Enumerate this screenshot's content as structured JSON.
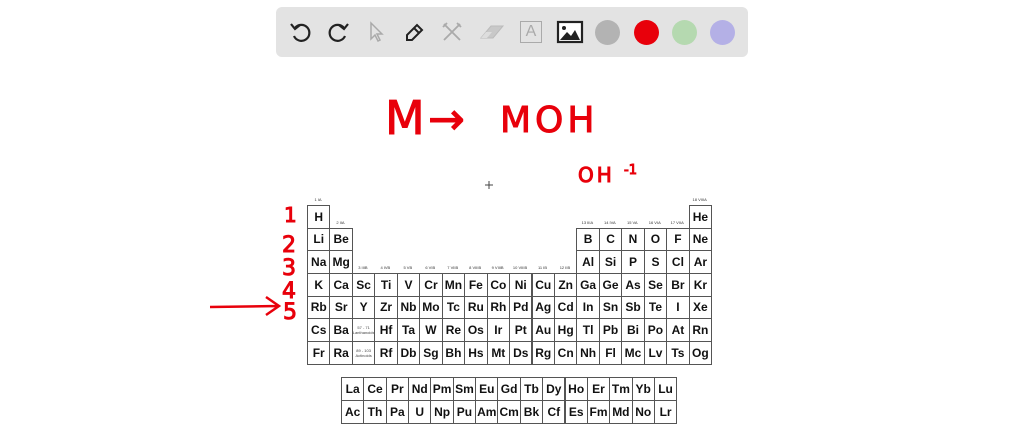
{
  "toolbar": {
    "tools": [
      {
        "name": "undo-icon",
        "label": "Undo"
      },
      {
        "name": "redo-icon",
        "label": "Redo"
      },
      {
        "name": "select-icon",
        "label": "Select"
      },
      {
        "name": "pen-icon",
        "label": "Pen"
      },
      {
        "name": "tools-icon",
        "label": "Tools"
      },
      {
        "name": "eraser-icon",
        "label": "Eraser"
      },
      {
        "name": "text-icon",
        "label": "Text"
      },
      {
        "name": "image-icon",
        "label": "Image"
      }
    ],
    "text_tool_glyph": "A",
    "colors": [
      "#b3b3b3",
      "#e8000b",
      "#b5d9b0",
      "#b4b0e6"
    ]
  },
  "annotations": {
    "reaction_m": "M",
    "reaction_arrow": "→",
    "reaction_product": "MOH",
    "hydroxide": "OH",
    "hydroxide_charge": "-1",
    "period_numbers": [
      "1",
      "2",
      "3",
      "4",
      "5"
    ],
    "pointer_arrow": "→",
    "color": "#e8000b"
  },
  "periodic_table": {
    "group_labels": [
      "1 IA",
      "2 IIA",
      "3 IIIB",
      "4 IVB",
      "5 VB",
      "6 VIB",
      "7 VIIB",
      "8 VIIIB",
      "9 VIIIB",
      "10 VIIIB",
      "11 IB",
      "12 IIB",
      "13 IIIA",
      "14 IVA",
      "15 VA",
      "16 VIA",
      "17 VIIA",
      "18 VIIIA"
    ],
    "rows": [
      [
        "H",
        "",
        "",
        "",
        "",
        "",
        "",
        "",
        "",
        "",
        "",
        "",
        "",
        "",
        "",
        "",
        "",
        "He"
      ],
      [
        "Li",
        "Be",
        "",
        "",
        "",
        "",
        "",
        "",
        "",
        "",
        "",
        "",
        "B",
        "C",
        "N",
        "O",
        "F",
        "Ne"
      ],
      [
        "Na",
        "Mg",
        "",
        "",
        "",
        "",
        "",
        "",
        "",
        "",
        "",
        "",
        "Al",
        "Si",
        "P",
        "S",
        "Cl",
        "Ar"
      ],
      [
        "K",
        "Ca",
        "Sc",
        "Ti",
        "V",
        "Cr",
        "Mn",
        "Fe",
        "Co",
        "Ni",
        "Cu",
        "Zn",
        "Ga",
        "Ge",
        "As",
        "Se",
        "Br",
        "Kr"
      ],
      [
        "Rb",
        "Sr",
        "Y",
        "Zr",
        "Nb",
        "Mo",
        "Tc",
        "Ru",
        "Rh",
        "Pd",
        "Ag",
        "Cd",
        "In",
        "Sn",
        "Sb",
        "Te",
        "I",
        "Xe"
      ],
      [
        "Cs",
        "Ba",
        "57 - 71 Lanthanoids",
        "Hf",
        "Ta",
        "W",
        "Re",
        "Os",
        "Ir",
        "Pt",
        "Au",
        "Hg",
        "Tl",
        "Pb",
        "Bi",
        "Po",
        "At",
        "Rn"
      ],
      [
        "Fr",
        "Ra",
        "89 - 103 Actinoids",
        "Rf",
        "Db",
        "Sg",
        "Bh",
        "Hs",
        "Mt",
        "Ds",
        "Rg",
        "Cn",
        "Nh",
        "Fl",
        "Mc",
        "Lv",
        "Ts",
        "Og"
      ]
    ],
    "lanthanides": [
      "La",
      "Ce",
      "Pr",
      "Nd",
      "Pm",
      "Sm",
      "Eu",
      "Gd",
      "Tb",
      "Dy",
      "Ho",
      "Er",
      "Tm",
      "Yb",
      "Lu"
    ],
    "actinides": [
      "Ac",
      "Th",
      "Pa",
      "U",
      "Np",
      "Pu",
      "Am",
      "Cm",
      "Bk",
      "Cf",
      "Es",
      "Fm",
      "Md",
      "No",
      "Lr"
    ]
  }
}
